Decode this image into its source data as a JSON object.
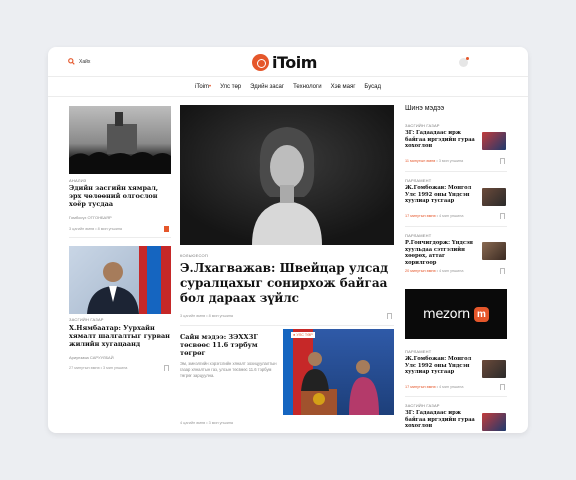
{
  "header": {
    "search_label": "Хайх",
    "logo_text": "iToim"
  },
  "nav": {
    "items": [
      "iToim",
      "Улс төр",
      "Эдийн засаг",
      "Технологи",
      "Хэв маяг",
      "Бусад"
    ]
  },
  "left": {
    "story1": {
      "kicker": "АНАЛИЗ",
      "title": "Эдийн засгийн хямрал, эрх чөлөөний олгослон хоёр тусдаа",
      "author": "Гомбосүх ОТГОНБАЯР",
      "meta": "3 цагийн өмнө  •  8 мин уншина"
    },
    "story2": {
      "kicker": "ЗАСГИЙН ГАЗАР",
      "title": "Х.Нямбаатар: Уурхайн хямалт шалгалтыг гурван жилийн хугацаанд",
      "author": "Ариунзаяа САРУУЛБАЙ",
      "meta": "27 минутын өмнө  •  3 мин уншина"
    }
  },
  "center": {
    "main": {
      "kicker": "КОЛЬЮЕСОП",
      "title": "Э.Лхагважав: Швейцар улсад суралцахыг сонирхож байгаа бол дараах зүйлс",
      "meta": "3 цагийн өмнө  •  8 мин уншина"
    },
    "sub": {
      "title": "Сайн мэдээ: ЗЭХХЗГ төсвөөс 11.6 тэрбум төгрөг",
      "desc": "Эм, эмнэлгийн хэрэгслийн хяналт зохицуулалтын газар хяналтын газ, улсын төсвөөс 11.6 тэрбум төгрөг зарцуулна.",
      "meta": "4 цагийн өмнө  •  3 мин уншина",
      "live": "УЛС ТӨР"
    }
  },
  "side": {
    "title": "Шинэ мэдээ",
    "items": [
      {
        "kicker": "ЗАСГИЙН ГАЗАР",
        "title": "ЗГ: Гадаадаас ирж байгаа иргэдийн гураа хохоглон",
        "meta_red": "11 минутын өмнө",
        "meta": "3 мин уншина"
      },
      {
        "kicker": "ПАРЛАМЕНТ",
        "title": "Ж.Гомбожав: Монгол Улс 1992 оны Үндсэн хуулиар тусгаар",
        "meta_red": "17 минутын өмнө",
        "meta": "4 мин уншина"
      },
      {
        "kicker": "ПАРЛАМЕНТ",
        "title": "Р.Гончигдорж: Үндсэн хуульдаа сэтгэлийн хөөрөх, аттаг хорилгоор",
        "meta_red": "20 минутын өмнө",
        "meta": "4 мин уншина"
      },
      {
        "kicker": "ПАРЛАМЕНТ",
        "title": "Ж.Гомбожав: Монгол Улс 1992 оны Үндсэн хуулиар тусгаар",
        "meta_red": "17 минутын өмнө",
        "meta": "4 мин уншина"
      },
      {
        "kicker": "ЗАСГИЙН ГАЗАР",
        "title": "ЗГ: Гадаадаас ирж байгаа иргэдийн гураа хохоглон",
        "meta_red": "",
        "meta": ""
      }
    ],
    "ad_text": "mezorn",
    "ad_mark": "m"
  }
}
